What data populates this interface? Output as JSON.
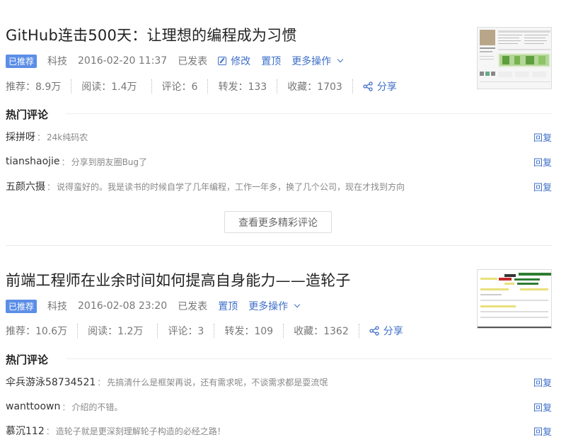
{
  "articles": [
    {
      "title": "GitHub连击500天：让理想的编程成为习惯",
      "badge": "已推荐",
      "category": "科技",
      "datetime": "2016-02-20 11:37",
      "status": "已发表",
      "edit_label": "修改",
      "pin_label": "置顶",
      "more_ops_label": "更多操作",
      "stats": {
        "recommend": "推荐：8.9万",
        "read": "阅读：1.4万",
        "comments": "评论：6",
        "forward": "转发：133",
        "favorite": "收藏：1703"
      },
      "share_label": "分享",
      "hot_comments_title": "热门评论",
      "comments": [
        {
          "user": "採拼呀",
          "text": "24k纯码农",
          "reply": "回复"
        },
        {
          "user": "tianshaojie",
          "text": "分享到朋友圈Bug了",
          "reply": "回复"
        },
        {
          "user": "五颜六摄",
          "text": "说得蛮好的。我是读书的时候自学了几年编程，工作一年多，换了几个公司，现在才找到方向",
          "reply": "回复"
        }
      ],
      "more_comments_label": "查看更多精彩评论"
    },
    {
      "title": "前端工程师在业余时间如何提高自身能力——造轮子",
      "badge": "已推荐",
      "category": "科技",
      "datetime": "2016-02-08 23:20",
      "status": "已发表",
      "pin_label": "置顶",
      "more_ops_label": "更多操作",
      "stats": {
        "recommend": "推荐：10.6万",
        "read": "阅读：1.2万",
        "comments": "评论：3",
        "forward": "转发：109",
        "favorite": "收藏：1362"
      },
      "share_label": "分享",
      "hot_comments_title": "热门评论",
      "comments": [
        {
          "user": "伞兵游泳58734521",
          "text": "先搞清什么是框架再说，还有需求呢，不谈需求都是耍流氓",
          "reply": "回复"
        },
        {
          "user": "wanttoown",
          "text": "介绍的不错。",
          "reply": "回复"
        },
        {
          "user": "慕沉112",
          "text": "造轮子就是更深刻理解轮子构造的必经之路！",
          "reply": "回复"
        }
      ]
    }
  ],
  "colors": {
    "accent": "#3e6fc7",
    "badge_bg": "#5b8ee6"
  }
}
